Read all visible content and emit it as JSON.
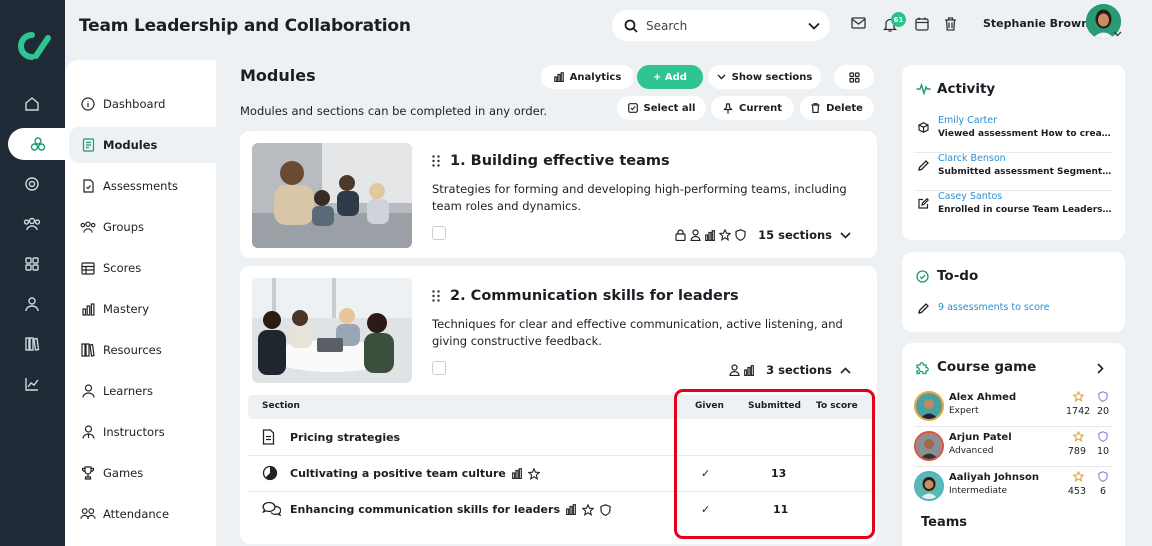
{
  "app": {
    "title": "Team Leadership and Collaboration",
    "brand_color": "#2fc593",
    "rail_color": "#1f2a37"
  },
  "topbar": {
    "search_placeholder": "Search",
    "notification_count": "61",
    "user_name": "Stephanie Brown"
  },
  "rail": {
    "icons": [
      "home-icon",
      "course-icon",
      "target-icon",
      "people-icon",
      "grid-icon",
      "user-icon",
      "library-icon",
      "chart-icon"
    ],
    "active_index": 1
  },
  "nav": {
    "items": [
      {
        "label": "Dashboard",
        "icon": "info-icon"
      },
      {
        "label": "Modules",
        "icon": "document-icon",
        "active": true
      },
      {
        "label": "Assessments",
        "icon": "assessment-icon"
      },
      {
        "label": "Groups",
        "icon": "groups-icon"
      },
      {
        "label": "Scores",
        "icon": "table-icon"
      },
      {
        "label": "Mastery",
        "icon": "bars-icon"
      },
      {
        "label": "Resources",
        "icon": "books-icon"
      },
      {
        "label": "Learners",
        "icon": "person-icon"
      },
      {
        "label": "Instructors",
        "icon": "instructor-icon"
      },
      {
        "label": "Games",
        "icon": "trophy-icon"
      },
      {
        "label": "Attendance",
        "icon": "attendance-icon"
      }
    ]
  },
  "modules": {
    "heading": "Modules",
    "description": "Modules and sections can be completed in any order.",
    "toolbar": {
      "analytics": "Analytics",
      "add": "+ Add",
      "show_sections": "Show sections",
      "select_all": "Select all",
      "current": "Current",
      "delete": "Delete"
    },
    "cards": [
      {
        "number": "1.",
        "title": "Building effective teams",
        "description": "Strategies for forming and developing high-performing teams, including team roles and dynamics.",
        "sections": "15 sections",
        "expanded": false
      },
      {
        "number": "2.",
        "title": "Communication skills for leaders",
        "description": "Techniques for clear and effective communication, active listening, and giving constructive feedback.",
        "sections": "3 sections",
        "expanded": true
      }
    ],
    "table": {
      "headers": {
        "section": "Section",
        "given": "Given",
        "submitted": "Submitted",
        "to_score": "To score"
      },
      "rows": [
        {
          "name": "Pricing strategies",
          "icon": "document-icon",
          "given": "",
          "submitted": "",
          "to_score": ""
        },
        {
          "name": "Cultivating a positive team culture",
          "icon": "pie-icon",
          "given": "✓",
          "submitted": "13",
          "to_score": ""
        },
        {
          "name": "Enhancing communication skills for leaders",
          "icon": "chat-icon",
          "given": "✓",
          "submitted": "11",
          "to_score": ""
        }
      ]
    }
  },
  "activity": {
    "title": "Activity",
    "items": [
      {
        "who": "Emily Carter",
        "what": "Viewed assessment How to create g…",
        "icon": "cube-icon"
      },
      {
        "who": "Clarck Benson",
        "what": "Submitted assessment Segmentati…",
        "icon": "pencil-icon"
      },
      {
        "who": "Casey Santos",
        "what": "Enrolled in course Team Leadership …",
        "icon": "edit-icon"
      }
    ]
  },
  "todo": {
    "title": "To-do",
    "item": "9 assessments to score"
  },
  "game": {
    "title": "Course game",
    "players": [
      {
        "name": "Alex Ahmed",
        "level": "Expert",
        "points": "1742",
        "badges": "20"
      },
      {
        "name": "Arjun Patel",
        "level": "Advanced",
        "points": "789",
        "badges": "10"
      },
      {
        "name": "Aaliyah Johnson",
        "level": "Intermediate",
        "points": "453",
        "badges": "6"
      }
    ],
    "teams_title": "Teams"
  }
}
